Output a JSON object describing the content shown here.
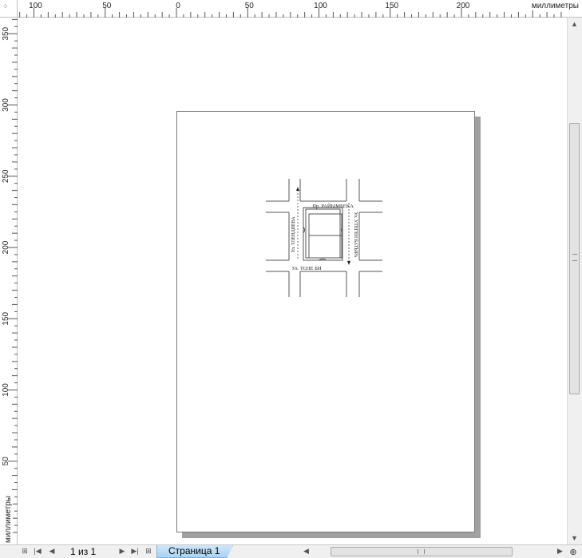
{
  "ruler": {
    "unit": "миллиметры",
    "h_labels": [
      {
        "mm": 100,
        "text": "100"
      },
      {
        "mm": 50,
        "text": "50"
      },
      {
        "mm": 0,
        "text": "0"
      },
      {
        "mm": 50,
        "text": "50"
      },
      {
        "mm": 100,
        "text": "100"
      },
      {
        "mm": 150,
        "text": "150"
      },
      {
        "mm": 200,
        "text": "200"
      }
    ],
    "v_labels": [
      {
        "mm": 350,
        "text": "350"
      },
      {
        "mm": 300,
        "text": "300"
      },
      {
        "mm": 250,
        "text": "250"
      },
      {
        "mm": 200,
        "text": "200"
      },
      {
        "mm": 150,
        "text": "150"
      },
      {
        "mm": 100,
        "text": "100"
      },
      {
        "mm": 50,
        "text": "50"
      }
    ]
  },
  "map": {
    "street_top": "Пр. РАЙЫМБЕКА",
    "street_bottom": "Ул. ТОЛЕ БИ",
    "street_left": "Ул. ТЛЕНДИЕВА",
    "street_right": "Ул. УТЕГЕН БАТЫРА"
  },
  "status": {
    "page_count": "1 из 1",
    "page_tab": "Страница 1"
  },
  "icons": {
    "add_page_before": "add-page-icon",
    "first_page": "first-page-icon",
    "prev_page": "prev-page-icon",
    "next_page": "next-page-icon",
    "last_page": "last-page-icon",
    "add_page_after": "add-page-icon",
    "zoom": "zoom-icon"
  }
}
